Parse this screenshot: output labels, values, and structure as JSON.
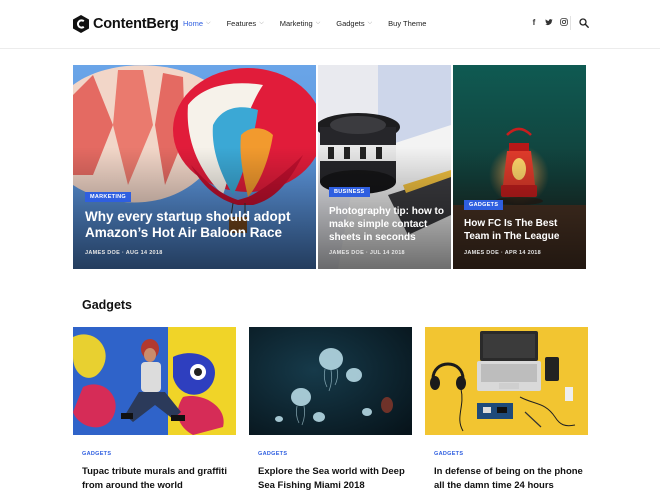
{
  "brand": {
    "name": "ContentBerg"
  },
  "nav": {
    "items": [
      {
        "label": "Home",
        "has_dropdown": true,
        "active": true
      },
      {
        "label": "Features",
        "has_dropdown": true
      },
      {
        "label": "Marketing",
        "has_dropdown": true
      },
      {
        "label": "Gadgets",
        "has_dropdown": true
      },
      {
        "label": "Buy Theme",
        "has_dropdown": false
      }
    ]
  },
  "header_icons": [
    "facebook-icon",
    "twitter-icon",
    "instagram-icon",
    "search-icon"
  ],
  "hero": [
    {
      "category": "MARKETING",
      "title_lines": [
        "Why every startup should adopt",
        "Amazon’s Hot Air Baloon Race"
      ],
      "author": "JAMES DOE",
      "date": "AUG 14 2018"
    },
    {
      "category": "BUSINESS",
      "title_lines": [
        "Photography tip: how to",
        "make simple contact",
        "sheets in seconds"
      ],
      "author": "JAMES DOE",
      "date": "JUL 14 2018"
    },
    {
      "category": "GADGETS",
      "title_lines": [
        "How FC Is The Best",
        "Team in The League"
      ],
      "author": "JAMES DOE",
      "date": "APR 14 2018"
    }
  ],
  "section": {
    "title": "Gadgets"
  },
  "cards": [
    {
      "category": "GADGETS",
      "title_lines": [
        "Tupac tribute murals and graffiti",
        "from around the world"
      ]
    },
    {
      "category": "GADGETS",
      "title_lines": [
        "Explore the Sea world with Deep",
        "Sea Fishing Miami 2018"
      ]
    },
    {
      "category": "GADGETS",
      "title_lines": [
        "In defense of being on the phone",
        "all the damn time 24 hours"
      ]
    }
  ],
  "colors": {
    "accent": "#2f5fe0"
  }
}
